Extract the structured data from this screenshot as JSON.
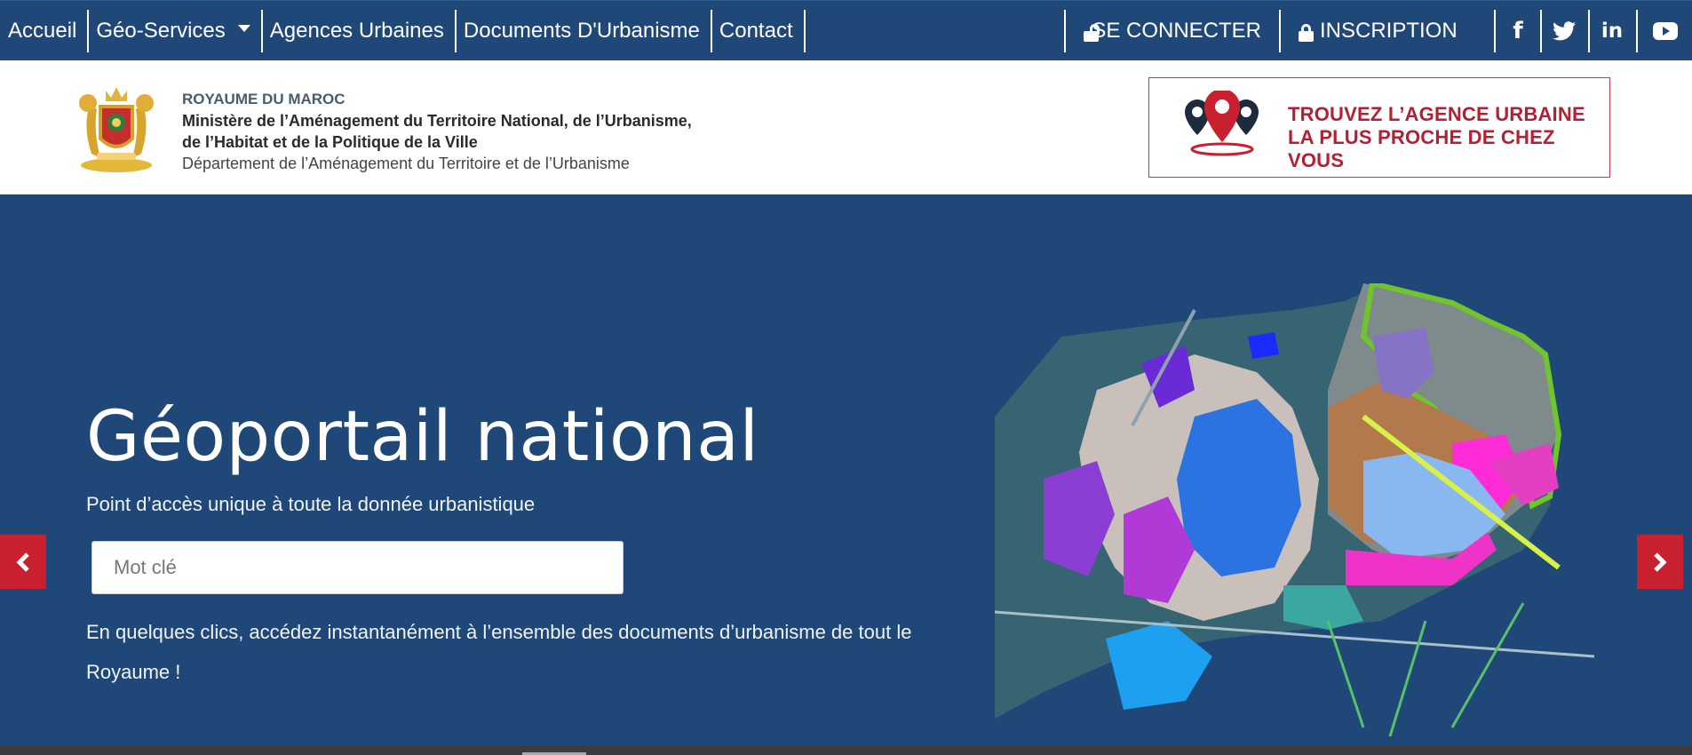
{
  "nav": {
    "items": [
      {
        "label": "Accueil"
      },
      {
        "label": "Géo-Services"
      },
      {
        "label": "Agences Urbaines"
      },
      {
        "label": "Documents D'Urbanisme"
      },
      {
        "label": "Contact"
      }
    ],
    "connect_label": "SE CONNECTER",
    "signup_label": "INSCRIPTION",
    "social": [
      "facebook-icon",
      "twitter-icon",
      "linkedin-icon",
      "youtube-icon"
    ]
  },
  "header": {
    "kingdom": "ROYAUME DU MAROC",
    "ministry_line1": "Ministère de l’Aménagement du Territoire National, de l’Urbanisme,",
    "ministry_line2": "de l’Habitat et de la Politique de la Ville",
    "department": "Département de l’Aménagement du Territoire et de l’Urbanisme",
    "banner_line1": "TROUVEZ L’AGENCE URBAINE",
    "banner_line2": "LA PLUS PROCHE DE CHEZ VOUS"
  },
  "hero": {
    "title": "Géoportail national",
    "subtitle": "Point d’accès unique à toute la donnée urbanistique",
    "search_placeholder": "Mot clé",
    "description": "En quelques clics, accédez instantanément à l’ensemble des documents d’urbanisme de tout le Royaume !"
  },
  "colors": {
    "primary": "#1f4878",
    "accent": "#c8202f",
    "banner_red": "#b41f33"
  }
}
